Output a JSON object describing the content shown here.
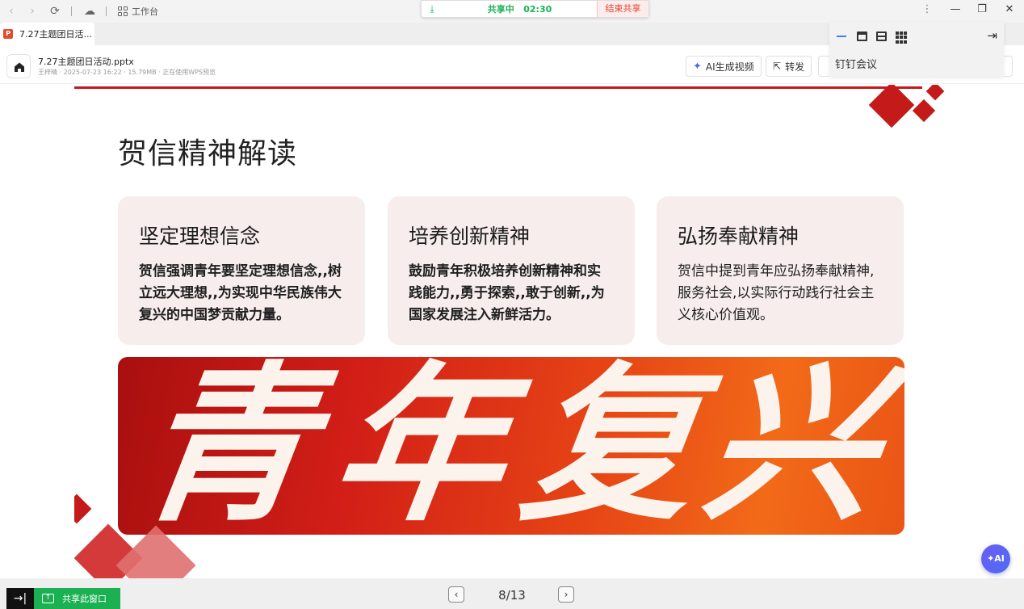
{
  "window": {
    "workbench_label": "工作台",
    "share_status": "共享中",
    "share_timer": "02:30",
    "end_share_label": "结束共享"
  },
  "tab": {
    "title": "7.27主题团日活..."
  },
  "file": {
    "name": "7.27主题团日活动.pptx",
    "meta": "王梓晴 · 2025-07-23 16:22 · 15.79MB · 正在使用WPS预览"
  },
  "actions": {
    "ai_video_label": "AI生成视频",
    "forward_label": "转发"
  },
  "dingtalk_panel": {
    "title": "钉钉会议"
  },
  "slide": {
    "title": "贺信精神解读",
    "cards": [
      {
        "heading": "坚定理想信念",
        "body": "贺信强调青年要坚定理想信念,,树立远大理想,,为实现中华民族伟大复兴的中国梦贡献力量。"
      },
      {
        "heading": "培养创新精神",
        "body": "鼓励青年积极培养创新精神和实践能力,,勇于探索,,敢于创新,,为国家发展注入新鲜活力。"
      },
      {
        "heading": "弘扬奉献精神",
        "body": "贺信中提到青年应弘扬奉献精神,服务社会,以实际行动践行社会主义核心价值观。"
      }
    ],
    "banner_text": "青年复兴"
  },
  "bottom": {
    "share_window_label": "共享此窗口",
    "page_indicator": "8/13"
  },
  "colors": {
    "accent_red": "#c41a1a",
    "share_green": "#1bb152",
    "card_bg": "#f8eded"
  }
}
